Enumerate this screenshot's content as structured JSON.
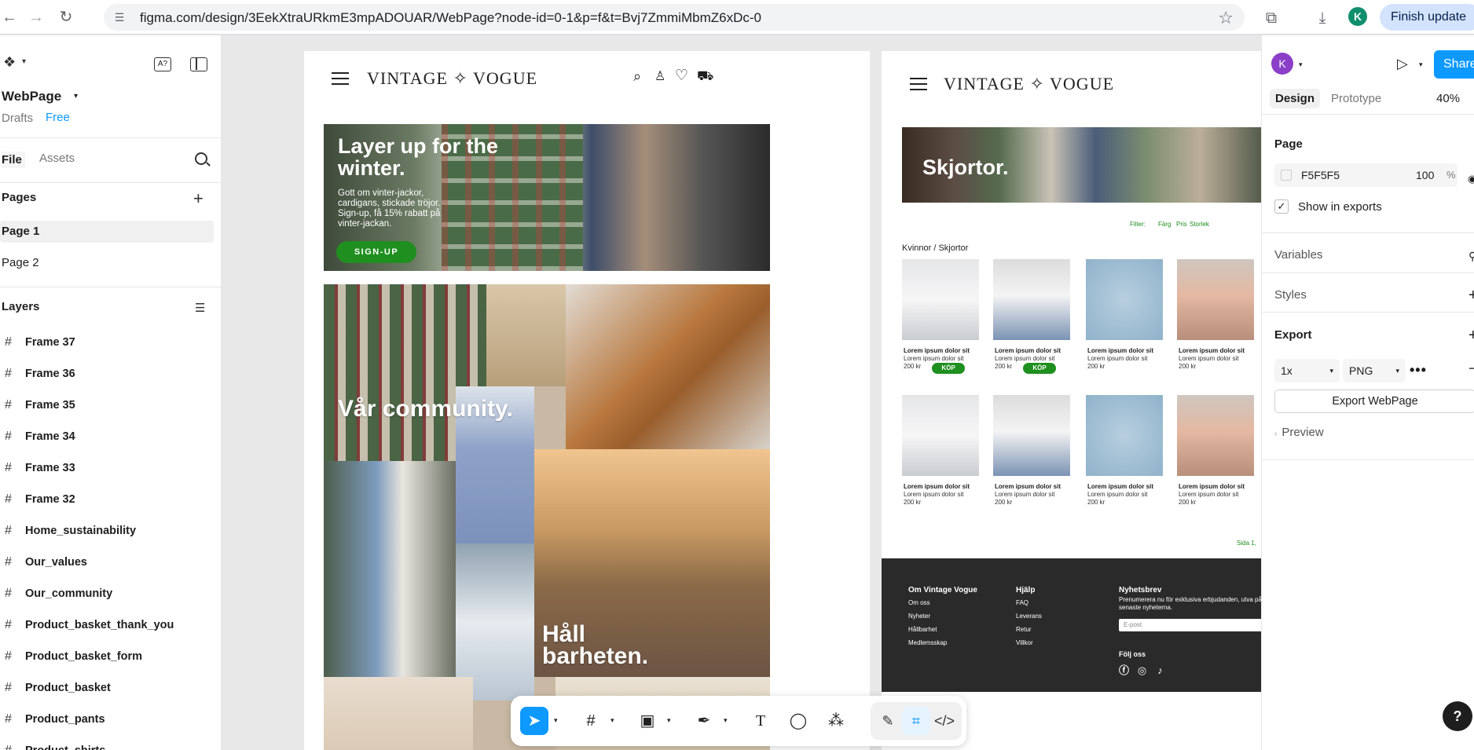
{
  "browser": {
    "url": "figma.com/design/3EekXtraURkmE3mpADOUAR/WebPage?node-id=0-1&p=f&t=Bvj7ZmmiMbmZ6xDc-0",
    "finish_update_label": "Finish update",
    "profile_initial": "K"
  },
  "left_panel": {
    "file_name": "WebPage",
    "drafts_label": "Drafts",
    "plan_label": "Free",
    "tabs": {
      "file": "File",
      "assets": "Assets"
    },
    "pages_title": "Pages",
    "pages": [
      "Page 1",
      "Page 2"
    ],
    "layers_title": "Layers",
    "layers": [
      "Frame 37",
      "Frame 36",
      "Frame 35",
      "Frame 34",
      "Frame 33",
      "Frame 32",
      "Home_sustainability",
      "Our_values",
      "Our_community",
      "Product_basket_thank_you",
      "Product_basket_form",
      "Product_basket",
      "Product_pants",
      "Product_shirts"
    ]
  },
  "frame1": {
    "brand": "VINTAGE ✧ VOGUE",
    "hero_title": "Layer up for the winter.",
    "hero_text": "Gott om vinter-jackor, cardigans, stickade tröjor. Sign-up, få 15% rabatt på vinter-jackan.",
    "signup_label": "SIGN-UP",
    "community_label": "Vår community.",
    "sustainability_label": "Håll barheten."
  },
  "frame2": {
    "brand": "VINTAGE ✧ VOGUE",
    "hero_title": "Skjortor.",
    "filters": [
      "Filter:",
      "Färg",
      "Pris",
      "Storlek"
    ],
    "breadcrumb": "Kvinnor / Skjortor",
    "products": [
      {
        "title": "Lorem ipsum dolor sit",
        "sub": "Lorem ipsum dolor sit",
        "price": "200 kr",
        "buy": "KÖP"
      },
      {
        "title": "Lorem ipsum dolor sit",
        "sub": "Lorem ipsum dolor sit",
        "price": "200 kr",
        "buy": "KÖP"
      },
      {
        "title": "Lorem ipsum dolor sit",
        "sub": "Lorem ipsum dolor sit",
        "price": "200 kr"
      },
      {
        "title": "Lorem ipsum dolor sit",
        "sub": "Lorem ipsum dolor sit",
        "price": "200 kr"
      },
      {
        "title": "Lorem ipsum dolor sit",
        "sub": "Lorem ipsum dolor sit",
        "price": "200 kr"
      },
      {
        "title": "Lorem ipsum dolor sit",
        "sub": "Lorem ipsum dolor sit",
        "price": "200 kr"
      },
      {
        "title": "Lorem ipsum dolor sit",
        "sub": "Lorem ipsum dolor sit",
        "price": "200 kr"
      },
      {
        "title": "Lorem ipsum dolor sit",
        "sub": "Lorem ipsum dolor sit",
        "price": "200 kr"
      }
    ],
    "pagination": "Sida 1,",
    "footer": {
      "about_title": "Om Vintage Vogue",
      "about_links": [
        "Om oss",
        "Nyheter",
        "Hållbarhet",
        "Medlemsskap"
      ],
      "help_title": "Hjälp",
      "help_links": [
        "FAQ",
        "Leverans",
        "Retur",
        "Villkor"
      ],
      "newsletter_title": "Nyhetsbrev",
      "newsletter_text": "Prenumerera nu för exklusiva erbjudanden, utva på de senaste nyheterna.",
      "email_placeholder": "E-post",
      "follow_title": "Följ oss"
    }
  },
  "right_panel": {
    "user_initial": "K",
    "share_label": "Share",
    "tabs": {
      "design": "Design",
      "prototype": "Prototype"
    },
    "zoom": "40%",
    "page_section": "Page",
    "page_color": "F5F5F5",
    "page_opacity": "100",
    "percent": "%",
    "show_in_exports": "Show in exports",
    "variables": "Variables",
    "styles": "Styles",
    "export_section": "Export",
    "export_scale": "1x",
    "export_format": "PNG",
    "export_button": "Export WebPage",
    "preview": "Preview"
  },
  "colors": {
    "accent": "#0d99ff",
    "brand_green": "#1f8f1f",
    "footer_bg": "#2a2a2a"
  }
}
